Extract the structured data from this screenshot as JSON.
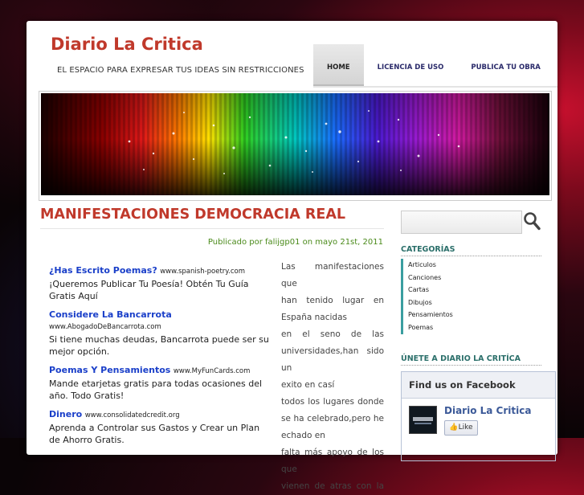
{
  "site": {
    "title": "Diario La Critica",
    "tagline": "EL ESPACIO PARA EXPRESAR TUS IDEAS SIN RESTRICCIONES"
  },
  "nav": [
    {
      "label": "HOME",
      "active": true
    },
    {
      "label": "LICENCIA DE USO",
      "active": false
    },
    {
      "label": "PUBLICA TU OBRA",
      "active": false
    }
  ],
  "post": {
    "title": "MANIFESTACIONES DEMOCRACIA REAL",
    "meta": "Publicado por falijgp01 on mayo 21st, 2011",
    "lines": [
      "Las manifestaciones que",
      "han tenido lugar en",
      "España nacidas",
      "en el seno de las",
      "universidades,han sido un",
      "exito en casí",
      "todos los lugares donde",
      "se ha celebrado,pero he",
      "echado en",
      "falta más apoyo de los que",
      "vienen de atras con la"
    ]
  },
  "ads": [
    {
      "title": "¿Has Escrito Poemas?",
      "url": "www.spanish-poetry.com",
      "body": "¡Queremos Publicar Tu Poesía! Obtén Tu Guía Gratis Aquí"
    },
    {
      "title": "Considere La Bancarrota",
      "url": "www.AbogadoDeBancarrota.com",
      "body": "Si tiene muchas deudas, Bancarrota puede ser su mejor opción."
    },
    {
      "title": "Poemas Y Pensamientos",
      "url": "www.MyFunCards.com",
      "body": "Mande etarjetas gratis para todas ocasiones del año. Todo Gratis!"
    },
    {
      "title": "Dinero",
      "url": "www.consolidatedcredit.org",
      "body": "Aprenda a Controlar sus Gastos y Crear un Plan de Ahorro Gratis."
    }
  ],
  "sidebar": {
    "search_placeholder": "",
    "categories_title": "CATEGORÍAS",
    "categories": [
      "Articulos",
      "Canciones",
      "Cartas",
      "Dibujos",
      "Pensamientos",
      "Poemas"
    ],
    "join_title": "ÚNETE A DIARIO LA CRITÍCA",
    "facebook": {
      "header": "Find us on Facebook",
      "page_name": "Diario La Critica",
      "like_label": "Like"
    }
  },
  "colors": {
    "title_red": "#c0392b",
    "nav_text": "#2a2a6a",
    "meta_green": "#4a8a1a",
    "ad_link": "#1a3fc9",
    "widget_teal": "#2b6f6a",
    "facebook_blue": "#3b5998"
  }
}
